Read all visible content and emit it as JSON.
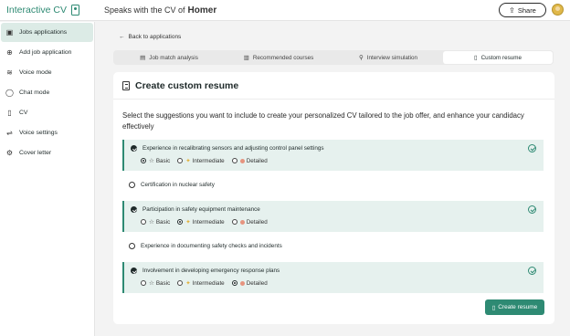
{
  "app": {
    "logo_text": "Interactive CV"
  },
  "header": {
    "prefix": "Speaks with the CV of",
    "name": "Homer",
    "share_label": "Share"
  },
  "sidebar": {
    "items": [
      {
        "label": "Jobs applications",
        "icon": "briefcase-icon",
        "active": true
      },
      {
        "label": "Add job application",
        "icon": "plus-circle-icon",
        "active": false
      },
      {
        "label": "Voice mode",
        "icon": "waveform-icon",
        "active": false
      },
      {
        "label": "Chat mode",
        "icon": "chat-icon",
        "active": false
      },
      {
        "label": "CV",
        "icon": "document-icon",
        "active": false
      },
      {
        "label": "Voice settings",
        "icon": "sliders-icon",
        "active": false
      },
      {
        "label": "Cover letter",
        "icon": "gear-icon",
        "active": false
      }
    ]
  },
  "nav": {
    "back_label": "Back to applications"
  },
  "tabs": [
    {
      "label": "Job match analysis",
      "icon": "chart-icon",
      "active": false
    },
    {
      "label": "Recommended courses",
      "icon": "book-icon",
      "active": false
    },
    {
      "label": "Interview simulation",
      "icon": "user-icon",
      "active": false
    },
    {
      "label": "Custom resume",
      "icon": "document-icon",
      "active": true
    }
  ],
  "card": {
    "title": "Create custom resume",
    "intro": "Select the suggestions you want to include to create your personalized CV tailored to the job offer, and enhance your candidacy effectively"
  },
  "level_labels": {
    "basic": "Basic",
    "intermediate": "Intermediate",
    "detailed": "Detailed"
  },
  "suggestions": [
    {
      "text": "Experience in recalibrating sensors and adjusting control panel settings",
      "selected": true,
      "level": "basic"
    },
    {
      "text": "Certification in nuclear safety",
      "selected": false,
      "level": null
    },
    {
      "text": "Participation in safety equipment maintenance",
      "selected": true,
      "level": "intermediate"
    },
    {
      "text": "Experience in documenting safety checks and incidents",
      "selected": false,
      "level": null
    },
    {
      "text": "Involvement in developing emergency response plans",
      "selected": true,
      "level": "detailed"
    }
  ],
  "actions": {
    "create_label": "Create resume"
  },
  "colors": {
    "accent": "#2e8a73",
    "selected_bg": "#e6f1ee",
    "intermediate_icon": "#e2b23b",
    "detailed_icon": "#e6947f"
  }
}
